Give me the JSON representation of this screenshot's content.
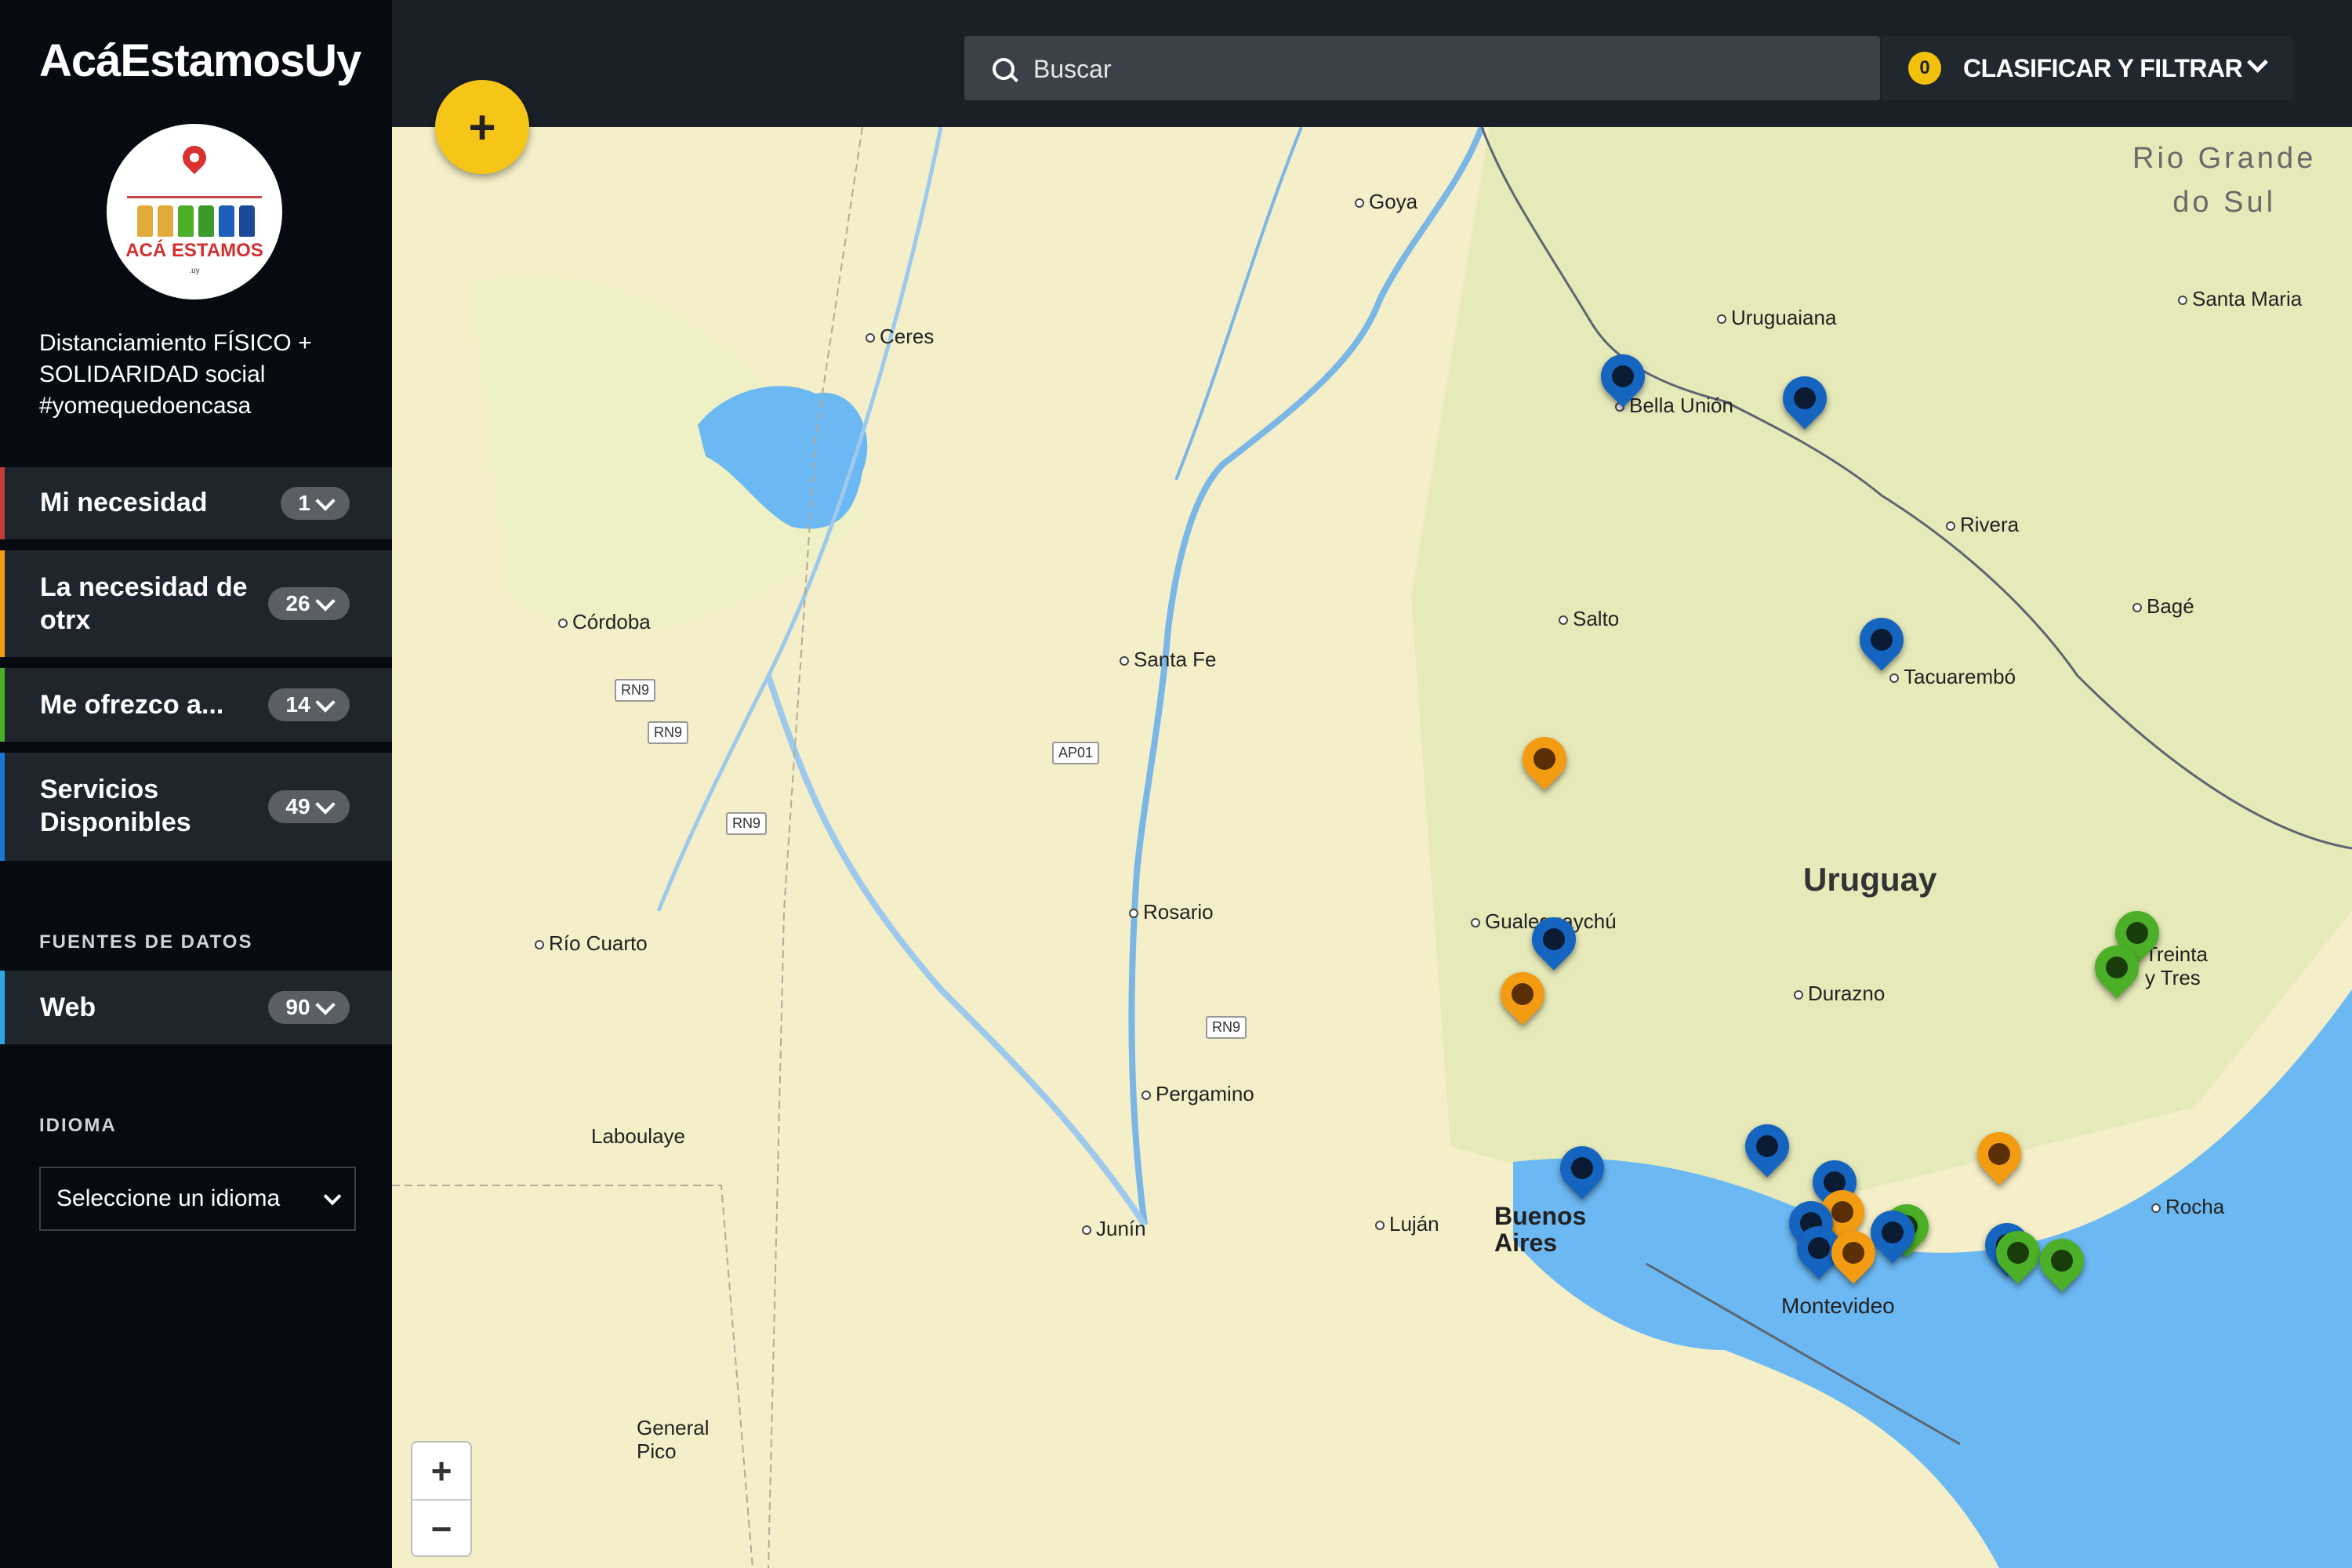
{
  "app": {
    "title": "AcáEstamosUy",
    "logo_caption": "ACÁ ESTAMOS",
    "logo_suffix": ".uy",
    "tagline": "Distanciamiento FÍSICO +\nSOLIDARIDAD social\n#yomequedoencasa"
  },
  "sidebar": {
    "categories": [
      {
        "label": "Mi necesidad",
        "count": "1",
        "color": "#c23b3b"
      },
      {
        "label": "La necesidad de otrx",
        "count": "26",
        "color": "#f39c12"
      },
      {
        "label": "Me ofrezco a...",
        "count": "14",
        "color": "#4caf28"
      },
      {
        "label": "Servicios Disponibles",
        "count": "49",
        "color": "#1976d2"
      }
    ],
    "sources_title": "FUENTES DE DATOS",
    "sources": [
      {
        "label": "Web",
        "count": "90",
        "color": "#29a8e0"
      }
    ],
    "language_title": "IDIOMA",
    "language_select": "Seleccione un idioma"
  },
  "topbar": {
    "search_placeholder": "Buscar",
    "filter_count": "0",
    "filter_label": "CLASIFICAR Y FILTRAR",
    "add_label": "+"
  },
  "map": {
    "zoom_in": "+",
    "zoom_out": "−",
    "country_label": "Uruguay",
    "region_label": "Rio Grande\ndo Sul",
    "capital_label": "Buenos\nAires",
    "cities": [
      "Goya",
      "Ceres",
      "Uruguaiana",
      "Santa Maria",
      "Bella Unión",
      "Rivera",
      "Salto",
      "Bagé",
      "Córdoba",
      "Santa Fe",
      "Tacuarembó",
      "Rosario",
      "Gualeguaychú",
      "Río Cuarto",
      "Durazno",
      "Treinta\ny Tres",
      "Pergamino",
      "Laboulaye",
      "Luján",
      "Rocha",
      "Junín",
      "Montevideo",
      "General\nPico"
    ],
    "roads": [
      "RN9",
      "RN9",
      "AP01",
      "RN9",
      "RN9"
    ]
  }
}
